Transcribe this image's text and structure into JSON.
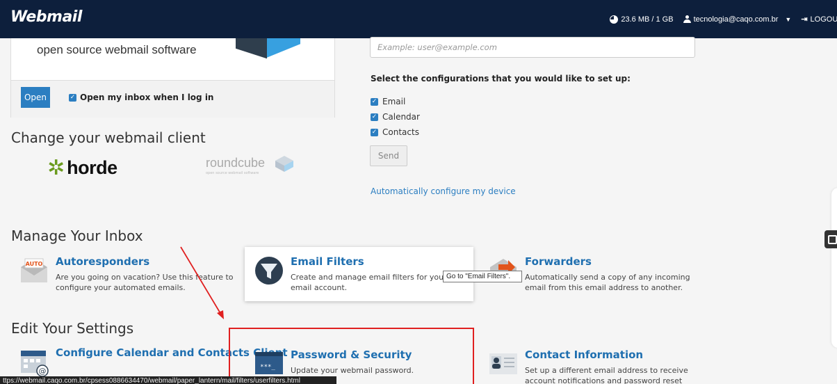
{
  "app": {
    "brand": "Webmail"
  },
  "topbar": {
    "quota": "23.6 MB / 1 GB",
    "user": "tecnologia@caqo.com.br",
    "logout": "LOGOUT"
  },
  "client_card": {
    "tagline": "open source webmail software",
    "open_label": "Open",
    "open_inbox_label": "Open my inbox when I log in"
  },
  "configure": {
    "email_placeholder": "Example: user@example.com",
    "select_title": "Select the configurations that you would like to set up:",
    "options": [
      "Email",
      "Calendar",
      "Contacts"
    ],
    "send_label": "Send",
    "auto_link": "Automatically configure my device"
  },
  "change_client": {
    "heading": "Change your webmail client",
    "horde": "horde",
    "roundcube": "roundcube",
    "roundcube_sub": "open source webmail software"
  },
  "manage_inbox": {
    "heading": "Manage Your Inbox",
    "tiles": [
      {
        "title": "Autoresponders",
        "desc": "Are you going on vacation? Use this feature to configure your automated emails.",
        "icon": "autoresponder-icon",
        "badge": "AUTO"
      },
      {
        "title": "Email Filters",
        "desc": "Create and manage email filters for your email account.",
        "icon": "filter-icon"
      },
      {
        "title": "Forwarders",
        "desc": "Automatically send a copy of any incoming email from this email address to another.",
        "icon": "forwarder-icon"
      }
    ]
  },
  "tooltip": "Go to \"Email Filters\".",
  "edit_settings": {
    "heading": "Edit Your Settings",
    "tiles": [
      {
        "title": "Configure Calendar and Contacts Client",
        "desc": "",
        "icon": "calendar-icon"
      },
      {
        "title": "Password & Security",
        "desc": "Update your webmail password.",
        "icon": "password-icon",
        "badge": "***_"
      },
      {
        "title": "Contact Information",
        "desc": "Set up a different email address to receive account notifications and password reset",
        "icon": "contact-icon"
      }
    ]
  },
  "statusbar": "ttps://webmail.caqo.com.br/cpsess0886634470/webmail/paper_lantern/mail/filters/userfilters.html",
  "colors": {
    "topbar": "#0d1f3c",
    "accent": "#2b7ec1",
    "highlight": "#e02020"
  }
}
